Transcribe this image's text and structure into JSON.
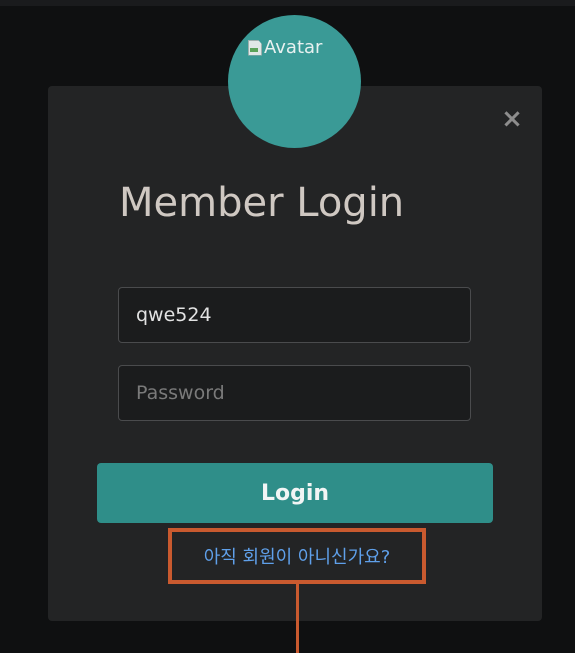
{
  "avatar": {
    "alt_text": "Avatar",
    "icon": "broken-image-icon"
  },
  "modal": {
    "close_label": "×",
    "title": "Member Login"
  },
  "form": {
    "username_value": "qwe524",
    "password_placeholder": "Password",
    "login_label": "Login"
  },
  "signup": {
    "link_text": "아직 회원이 아니신가요?"
  },
  "colors": {
    "accent": "#2f8e89",
    "avatar_bg": "#3a9a96",
    "link": "#5fa0ea",
    "annotation": "#c95a2f"
  }
}
